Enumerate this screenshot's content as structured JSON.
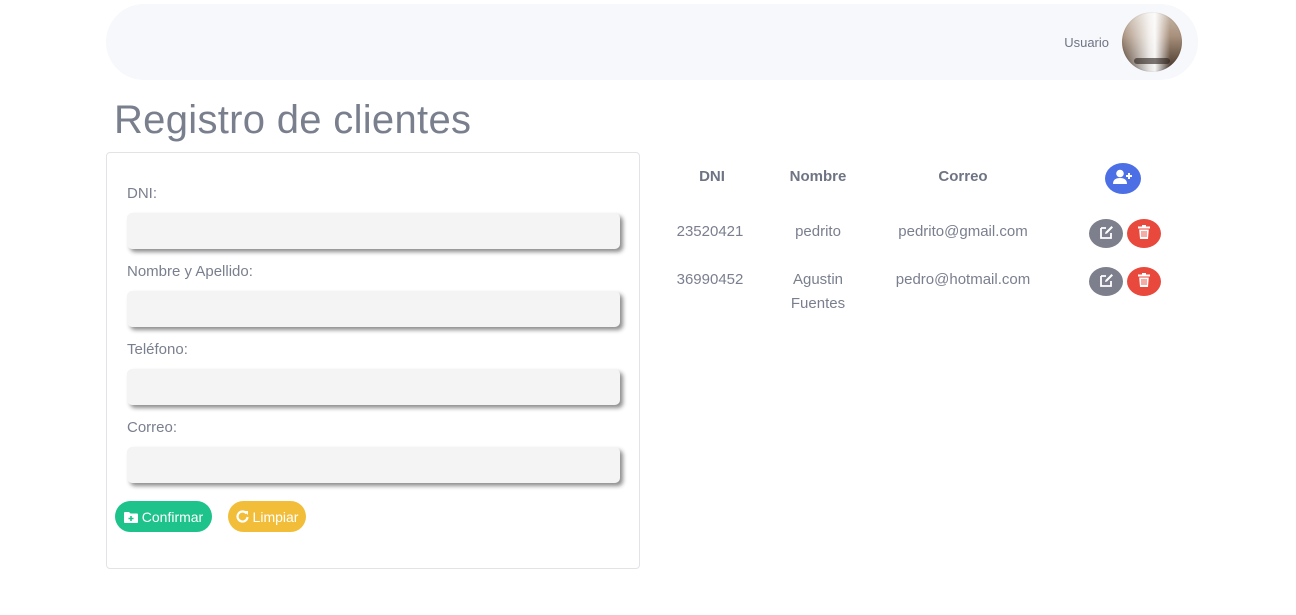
{
  "header": {
    "user_label": "Usuario"
  },
  "page": {
    "title": "Registro de clientes"
  },
  "form": {
    "fields": [
      {
        "label": "DNI:",
        "value": "",
        "placeholder": ""
      },
      {
        "label": "Nombre y Apellido:",
        "value": "",
        "placeholder": ""
      },
      {
        "label": "Teléfono:",
        "value": "",
        "placeholder": ""
      },
      {
        "label": "Correo:",
        "value": "",
        "placeholder": ""
      }
    ],
    "confirm_label": "Confirmar",
    "clear_label": "Limpiar"
  },
  "table": {
    "headers": [
      "DNI",
      "Nombre",
      "Correo"
    ],
    "rows": [
      {
        "dni": "23520421",
        "nombre_1": "pedrito",
        "nombre_2": "",
        "correo": "pedrito@gmail.com"
      },
      {
        "dni": "36990452",
        "nombre_1": "Agustin",
        "nombre_2": "Fuentes",
        "correo": "pedro@hotmail.com"
      }
    ]
  },
  "colors": {
    "confirm": "#1ec28b",
    "clear": "#f2be3a",
    "add": "#4c6fe6",
    "edit": "#7d7f8d",
    "delete": "#e9483c"
  },
  "icons": {
    "add": "user-plus-icon",
    "edit": "edit-icon",
    "delete": "trash-icon",
    "confirm": "folder-plus-icon",
    "clear": "refresh-icon"
  }
}
